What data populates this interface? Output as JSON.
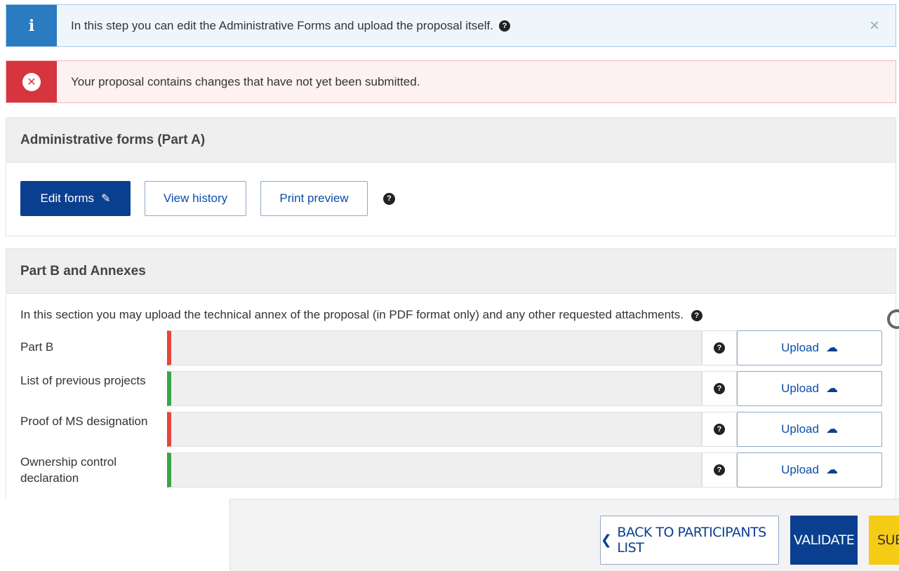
{
  "alerts": {
    "info": {
      "icon": "info-icon",
      "text": "In this step you can edit the Administrative Forms and upload the proposal itself.",
      "close": "×"
    },
    "error": {
      "icon": "error-circle-icon",
      "text": "Your proposal contains changes that have not yet been submitted."
    }
  },
  "part_a": {
    "title": "Administrative forms (Part A)",
    "edit_forms_label": "Edit forms",
    "view_history_label": "View history",
    "print_preview_label": "Print preview"
  },
  "part_b": {
    "title": "Part B and Annexes",
    "intro": "In this section you may upload the technical annex of the proposal (in PDF format only) and any other requested attachments.",
    "rows": [
      {
        "label": "Part B",
        "status": "red",
        "upload_label": "Upload"
      },
      {
        "label": "List of previous projects",
        "status": "green",
        "upload_label": "Upload"
      },
      {
        "label": "Proof of MS designation",
        "status": "red",
        "upload_label": "Upload"
      },
      {
        "label": "Ownership control declaration",
        "status": "green",
        "upload_label": "Upload"
      }
    ]
  },
  "footer": {
    "back_label": "BACK TO PARTICIPANTS LIST",
    "validate_label": "VALIDATE",
    "submit_label": "SUB"
  },
  "colors": {
    "primary": "#0a3f8f",
    "info": "#2a7bbf",
    "danger": "#d6343e",
    "status_red": "#e8453c",
    "status_green": "#3aa648",
    "submit": "#f5cc14"
  }
}
